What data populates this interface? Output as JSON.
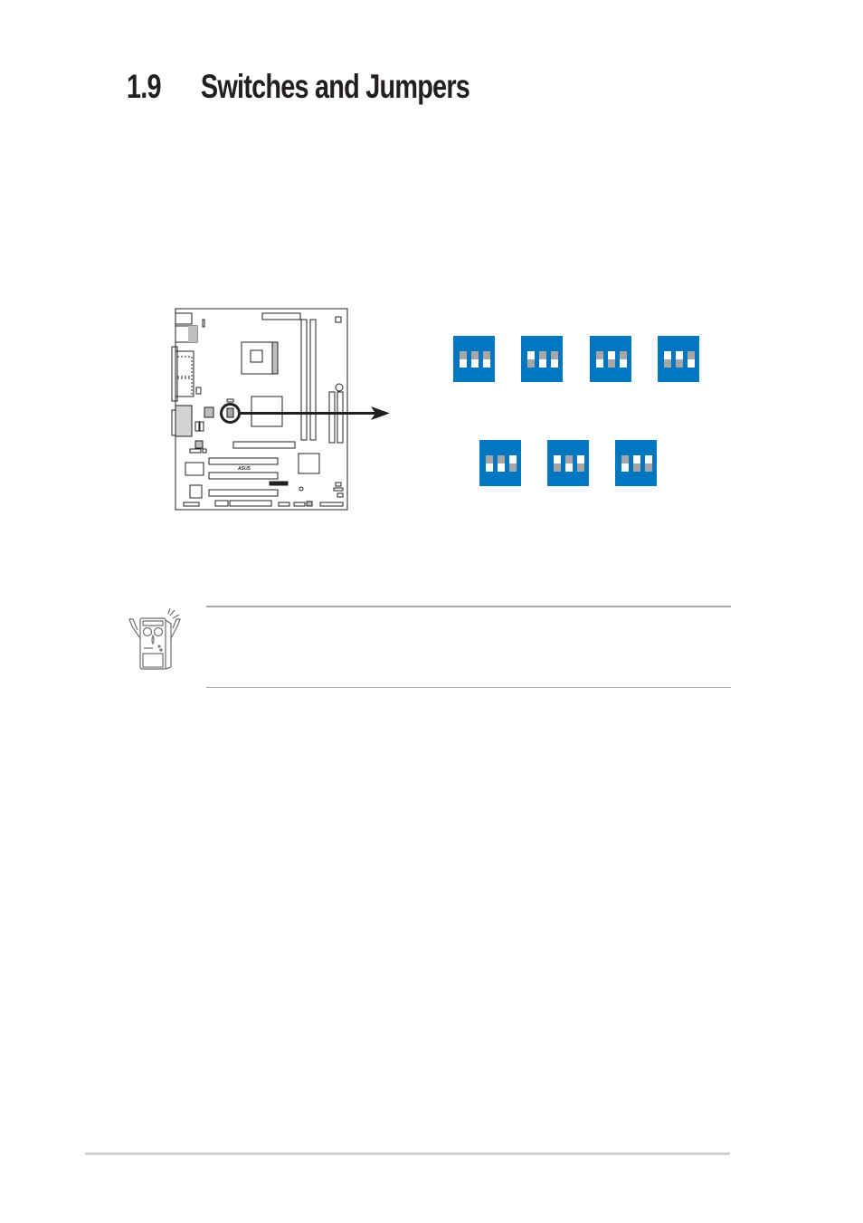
{
  "page": {
    "section_number": "1.9",
    "section_title": "Switches and Jumpers"
  },
  "figure": {
    "board_icon": "motherboard-layout-diagram",
    "board_logo": "ASUS",
    "highlight_icon": "circle-highlight-icon",
    "arrow_icon": "arrow-right-icon",
    "dip_switch_color": "#0077c0",
    "knob_color": "#a6a6a6",
    "dip_switches": [
      {
        "positions": [
          "up",
          "up",
          "up"
        ]
      },
      {
        "positions": [
          "down",
          "up",
          "up"
        ]
      },
      {
        "positions": [
          "up",
          "down",
          "up"
        ]
      },
      {
        "positions": [
          "down",
          "down",
          "up"
        ]
      },
      {
        "positions": [
          "up",
          "up",
          "down"
        ]
      },
      {
        "positions": [
          "down",
          "up",
          "down"
        ]
      },
      {
        "positions": [
          "up",
          "down",
          "down"
        ]
      }
    ]
  },
  "note": {
    "icon": "note-computer-mascot-icon",
    "rule_color": "#a7a9ac"
  },
  "footer": {
    "rule_color": "#d1d3d4"
  }
}
